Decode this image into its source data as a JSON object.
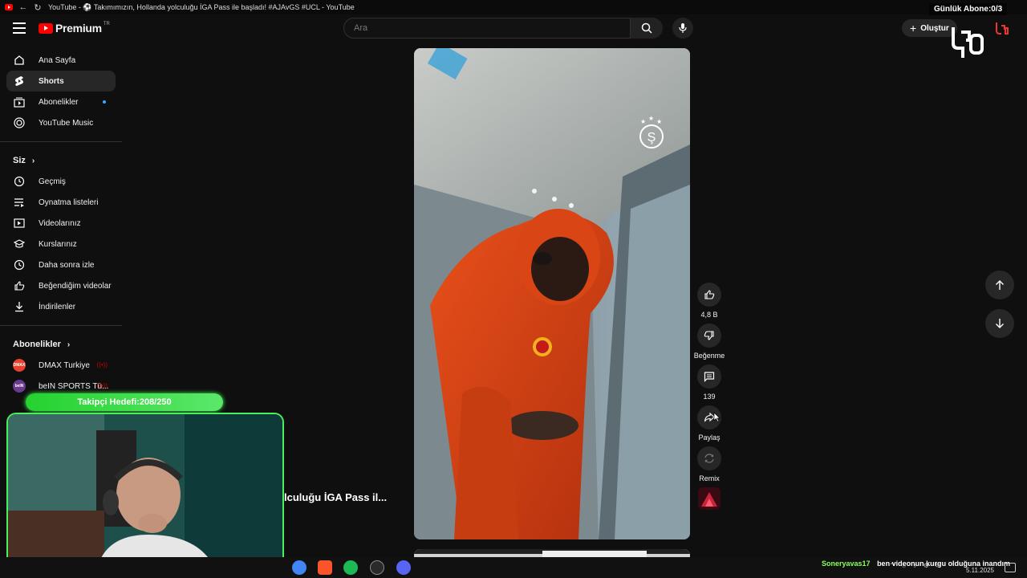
{
  "window": {
    "title": "YouTube - ⚽ Takımımızın, Hollanda yolculuğu İGA Pass ile başladı! #AJAvGS #UCL - YouTube"
  },
  "header": {
    "logo_text": "Premium",
    "country_code": "TR",
    "search_placeholder": "Ara",
    "create_label": "Oluştur"
  },
  "sidebar": {
    "main": [
      {
        "label": "Ana Sayfa",
        "icon": "home-icon"
      },
      {
        "label": "Shorts",
        "icon": "shorts-icon",
        "active": true
      },
      {
        "label": "Abonelikler",
        "icon": "subscriptions-icon",
        "new": true
      },
      {
        "label": "YouTube Music",
        "icon": "music-icon"
      }
    ],
    "you_title": "Siz",
    "you_items": [
      {
        "label": "Geçmiş",
        "icon": "history-icon"
      },
      {
        "label": "Oynatma listeleri",
        "icon": "playlist-icon"
      },
      {
        "label": "Videolarınız",
        "icon": "your-videos-icon"
      },
      {
        "label": "Kurslarınız",
        "icon": "courses-icon"
      },
      {
        "label": "Daha sonra izle",
        "icon": "watch-later-icon"
      },
      {
        "label": "Beğendiğim videolar",
        "icon": "liked-videos-icon"
      },
      {
        "label": "İndirilenler",
        "icon": "download-icon"
      }
    ],
    "subs_title": "Abonelikler",
    "subs_items": [
      {
        "label": "DMAX Turkiye",
        "avatar": "DMAX",
        "color": "#e8412d"
      },
      {
        "label": "beIN SPORTS Tü...",
        "avatar": "beIN",
        "color": "#6a3a8c"
      }
    ]
  },
  "short": {
    "actions": {
      "like_count": "4,8 B",
      "dislike_label": "Beğenme",
      "comment_count": "139",
      "share_label": "Paylaş",
      "remix_label": "Remix"
    },
    "overlay_title": "lculuğu İGA Pass il..."
  },
  "stream_overlay": {
    "follow_goal": "Takipçi Hedefi:208/250",
    "daily_subs": "Günlük Abone:0/3",
    "chat_user": "Soneryavas17",
    "chat_text": "ben videonun kurgu olduğuna inandım",
    "clock_date": "5.11.2025"
  },
  "colors": {
    "bg": "#0f0f0f",
    "accent_red": "#ff0000",
    "follow_green": "#25d12f"
  }
}
